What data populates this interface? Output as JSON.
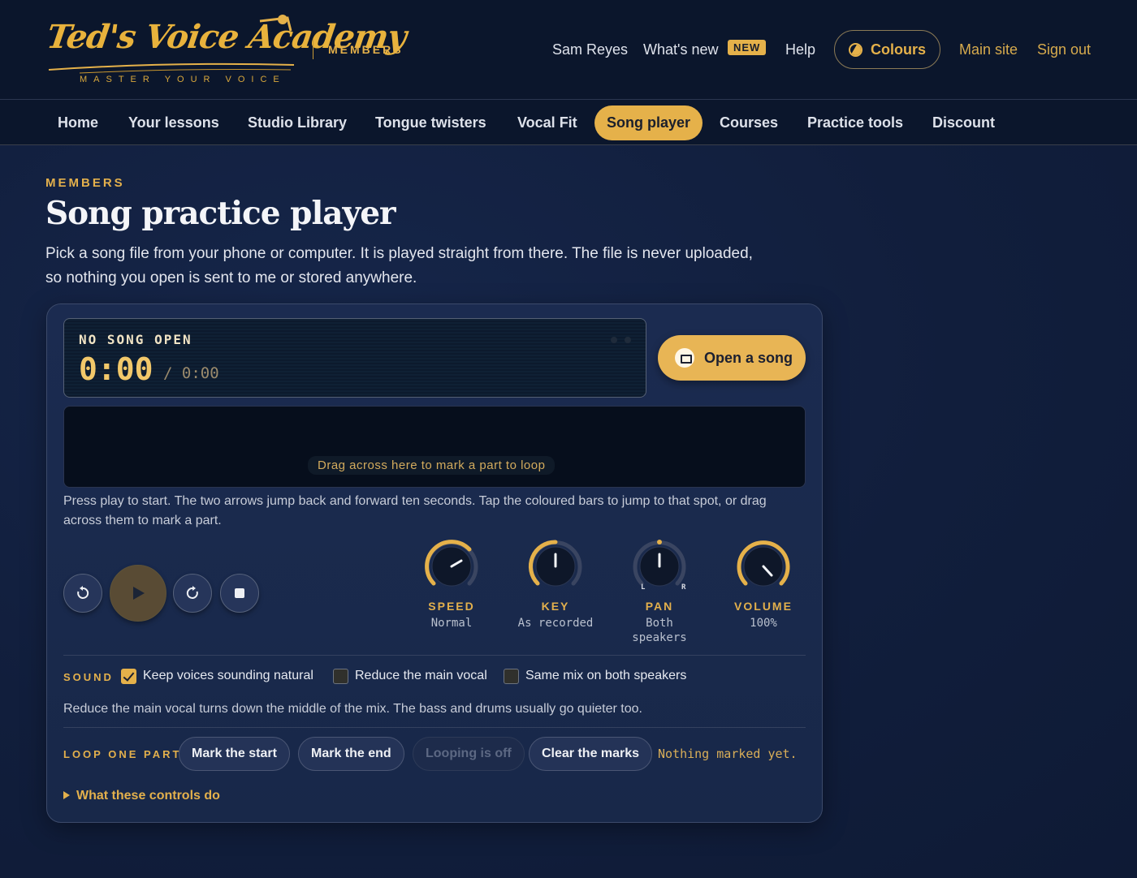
{
  "brand": {
    "name": "Ted's Voice Academy",
    "tagline": "MASTER YOUR VOICE",
    "section": "MEMBERS"
  },
  "topnav": {
    "user": "Sam Reyes",
    "whats_new": "What's new",
    "new_badge": "NEW",
    "help": "Help",
    "colours": "Colours",
    "main_site": "Main site",
    "sign_out": "Sign out"
  },
  "mainnav": {
    "items": [
      "Home",
      "Your lessons",
      "Studio Library",
      "Tongue twisters",
      "Vocal Fit",
      "Song player",
      "Courses",
      "Practice tools",
      "Discount"
    ],
    "active": "Song player"
  },
  "page": {
    "eyebrow": "MEMBERS",
    "title": "Song practice player",
    "intro": "Pick a song file from your phone or computer. It is played straight from there. The file is never uploaded, so nothing you open is sent to me or stored anywhere."
  },
  "player": {
    "status": "NO SONG OPEN",
    "current_time": "0:00",
    "total_time": "/ 0:00",
    "open_button": "Open a song",
    "wave_hint": "Drag across here to mark a part to loop",
    "help_text": "Press play to start. The two arrows jump back and forward ten seconds. Tap the coloured bars to jump to that spot, or drag across them to mark a part.",
    "knobs": [
      {
        "label": "SPEED",
        "value": "Normal"
      },
      {
        "label": "KEY",
        "value": "As recorded"
      },
      {
        "label": "PAN",
        "value": "Both speakers",
        "left_mark": "L",
        "right_mark": "R"
      },
      {
        "label": "VOLUME",
        "value": "100%",
        "level": 1.0
      }
    ],
    "sound": {
      "label": "SOUND",
      "options": [
        {
          "label": "Keep voices sounding natural",
          "checked": true
        },
        {
          "label": "Reduce the main vocal",
          "checked": false
        },
        {
          "label": "Same mix on both speakers",
          "checked": false
        }
      ],
      "note": "Reduce the main vocal turns down the middle of the mix. The bass and drums usually go quieter too."
    },
    "loop": {
      "label": "LOOP ONE PART",
      "mark_start": "Mark the start",
      "mark_end": "Mark the end",
      "looping": "Looping is off",
      "clear": "Clear the marks",
      "status": "Nothing marked yet."
    },
    "details_toggle": "What these controls do"
  },
  "colors": {
    "accent": "#e5b14a",
    "background": "#111e3c",
    "header": "#0b162c"
  }
}
